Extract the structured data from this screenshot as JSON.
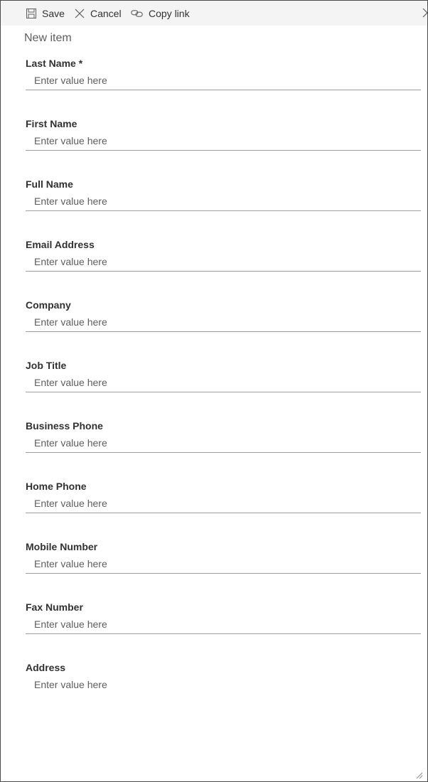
{
  "toolbar": {
    "save_label": "Save",
    "cancel_label": "Cancel",
    "copy_link_label": "Copy link",
    "icons": {
      "save": "save-icon",
      "cancel": "close-icon",
      "copy_link": "link-icon",
      "edge": "close-icon"
    }
  },
  "form": {
    "title": "New item",
    "fields": [
      {
        "label": "Last Name *",
        "placeholder": "Enter value here"
      },
      {
        "label": "First Name",
        "placeholder": "Enter value here"
      },
      {
        "label": "Full Name",
        "placeholder": "Enter value here"
      },
      {
        "label": "Email Address",
        "placeholder": "Enter value here"
      },
      {
        "label": "Company",
        "placeholder": "Enter value here"
      },
      {
        "label": "Job Title",
        "placeholder": "Enter value here"
      },
      {
        "label": "Business Phone",
        "placeholder": "Enter value here"
      },
      {
        "label": "Home Phone",
        "placeholder": "Enter value here"
      },
      {
        "label": "Mobile Number",
        "placeholder": "Enter value here"
      },
      {
        "label": "Fax Number",
        "placeholder": "Enter value here"
      },
      {
        "label": "Address",
        "placeholder": "Enter value here"
      }
    ]
  },
  "colors": {
    "toolbar_bg": "#f4f4f4",
    "text": "#323130",
    "placeholder": "#605e5c",
    "underline": "#a19f9d",
    "frame_border": "#4a4a4a"
  }
}
